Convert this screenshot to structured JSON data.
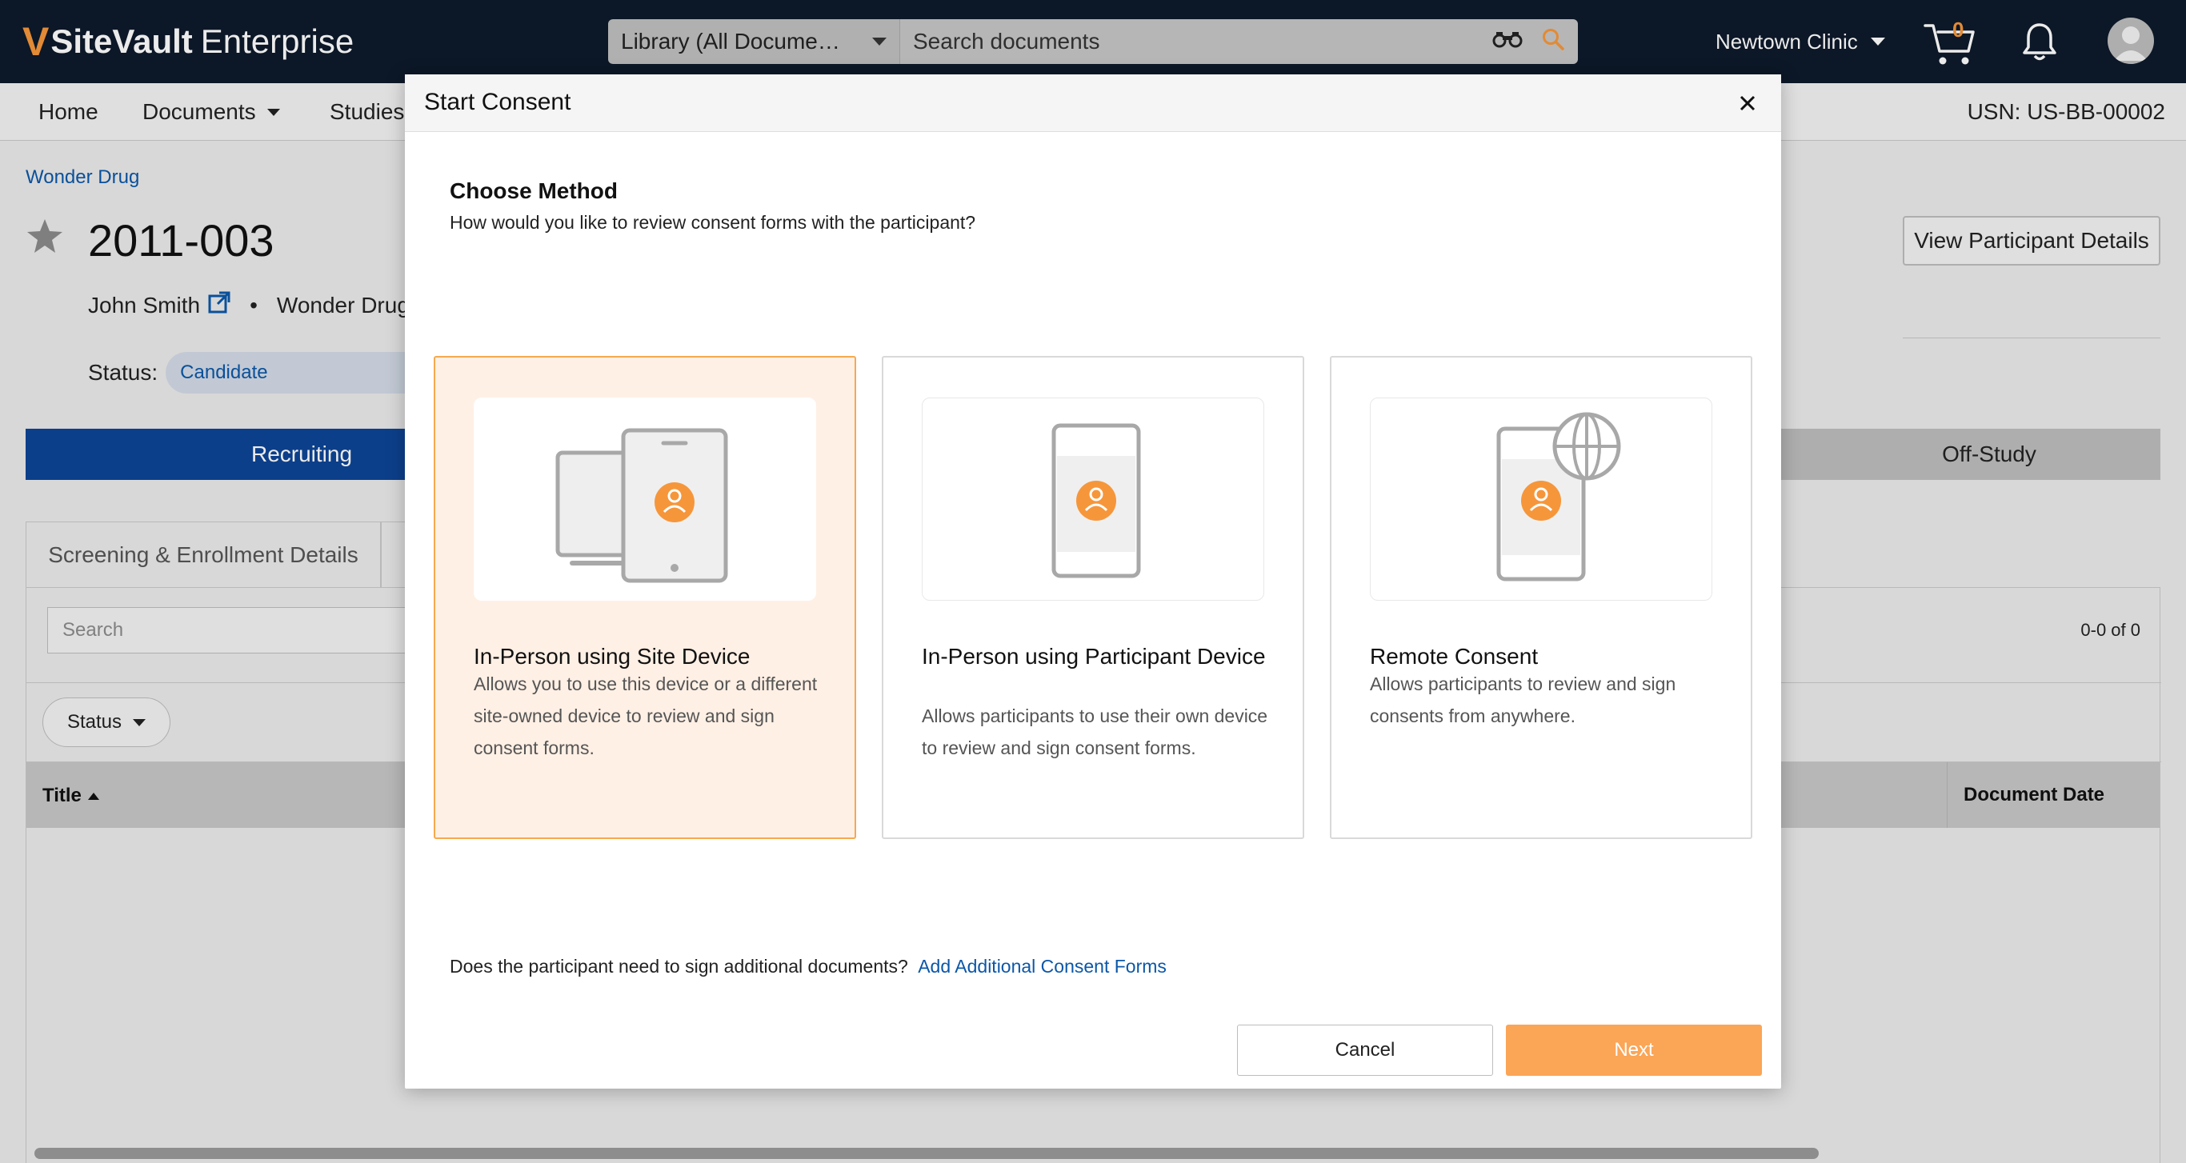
{
  "app": {
    "brand_mark": "V",
    "brand_bold": "SiteVault",
    "brand_rest": "Enterprise"
  },
  "topbar": {
    "library_select": "Library (All Docume…",
    "search_placeholder": "Search documents",
    "clinic": "Newtown Clinic",
    "cart_count": "0"
  },
  "nav": {
    "home": "Home",
    "documents": "Documents",
    "studies": "Studies",
    "usn": "USN: US-BB-00002"
  },
  "page": {
    "breadcrumb": "Wonder Drug",
    "participant_id": "2011-003",
    "participant_name": "John Smith",
    "separator": "•",
    "study_name": "Wonder Drug",
    "status_label": "Status:",
    "status_value": "Candidate",
    "view_details_button": "View Participant Details",
    "phase_active": "Recruiting",
    "phase_last": "Off-Study",
    "tab_screening": "Screening & Enrollment Details",
    "panel_search_placeholder": "Search",
    "result_count": "0-0 of 0",
    "status_filter": "Status",
    "col_title": "Title",
    "col_document_date": "Document Date"
  },
  "modal": {
    "title": "Start Consent",
    "heading": "Choose Method",
    "description": "How would you like to review consent forms with the participant?",
    "options": [
      {
        "title": "In-Person using Site Device",
        "description": "Allows you to use this device or a different site-owned device to review and sign consent forms.",
        "selected": true
      },
      {
        "title": "In-Person using Participant Device",
        "description": "Allows participants to use their own device to review and sign consent forms.",
        "selected": false
      },
      {
        "title": "Remote Consent",
        "description": "Allows participants to review and sign consents from anywhere.",
        "selected": false
      }
    ],
    "additional_question": "Does the participant need to sign additional documents?",
    "additional_link": "Add Additional Consent Forms",
    "cancel_button": "Cancel",
    "next_button": "Next"
  },
  "colors": {
    "topbar_bg": "#0e1a2b",
    "accent_orange": "#f6963a",
    "primary_blue": "#0e4596",
    "link_blue": "#0b57a8",
    "next_button_bg": "#fba556",
    "selected_card_bg": "#fff0e5"
  }
}
